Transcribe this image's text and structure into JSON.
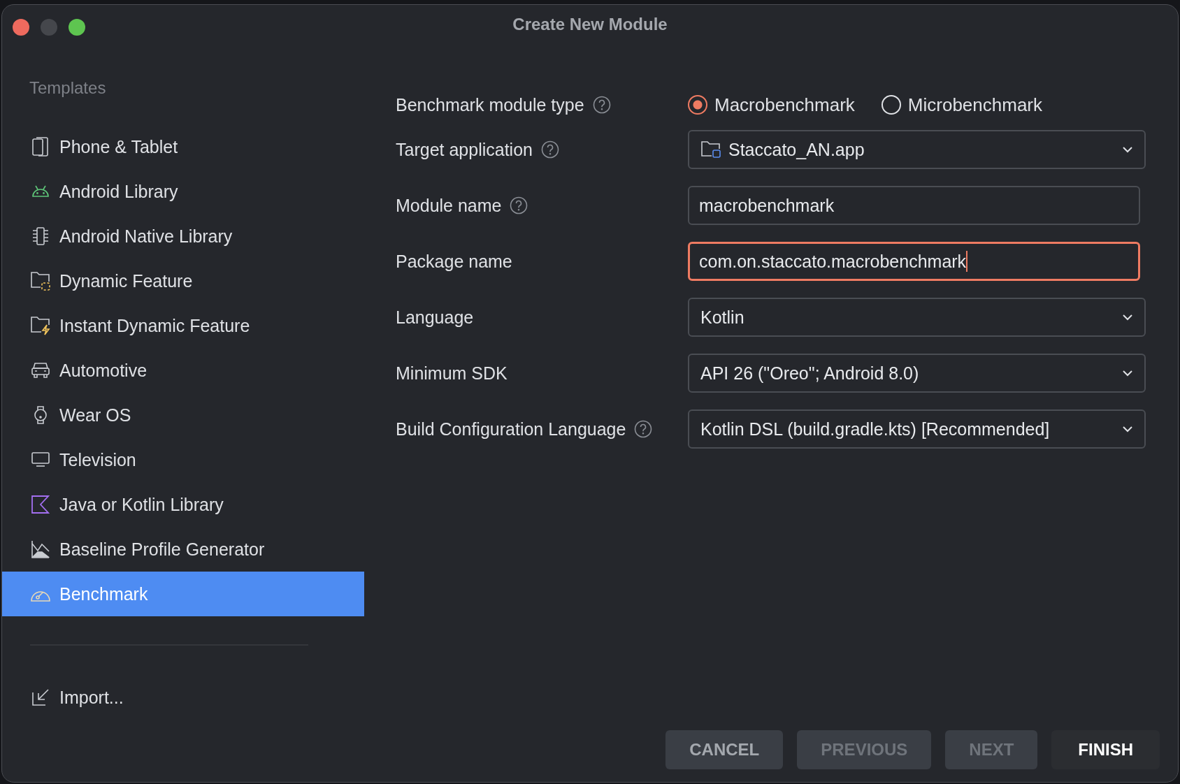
{
  "window": {
    "title": "Create New Module"
  },
  "sidebar": {
    "heading": "Templates",
    "items": [
      {
        "label": "Phone & Tablet",
        "selected": false
      },
      {
        "label": "Android Library",
        "selected": false
      },
      {
        "label": "Android Native Library",
        "selected": false
      },
      {
        "label": "Dynamic Feature",
        "selected": false
      },
      {
        "label": "Instant Dynamic Feature",
        "selected": false
      },
      {
        "label": "Automotive",
        "selected": false
      },
      {
        "label": "Wear OS",
        "selected": false
      },
      {
        "label": "Television",
        "selected": false
      },
      {
        "label": "Java or Kotlin Library",
        "selected": false
      },
      {
        "label": "Baseline Profile Generator",
        "selected": false
      },
      {
        "label": "Benchmark",
        "selected": true
      }
    ],
    "import": {
      "label": "Import..."
    }
  },
  "form": [
    {
      "kind": "radio",
      "label": "Benchmark module type",
      "help": true,
      "options": [
        {
          "label": "Macrobenchmark",
          "selected": true
        },
        {
          "label": "Microbenchmark",
          "selected": false
        }
      ]
    },
    {
      "kind": "dropdown",
      "label": "Target application",
      "help": true,
      "value": "Staccato_AN.app",
      "folder_icon": true
    },
    {
      "kind": "text",
      "label": "Module name",
      "help": true,
      "value": "macrobenchmark",
      "focused": false
    },
    {
      "kind": "text",
      "label": "Package name",
      "help": false,
      "value": "com.on.staccato.macrobenchmark",
      "focused": true
    },
    {
      "kind": "dropdown",
      "label": "Language",
      "help": false,
      "value": "Kotlin",
      "folder_icon": false
    },
    {
      "kind": "dropdown",
      "label": "Minimum SDK",
      "help": false,
      "value": "API 26 (\"Oreo\"; Android 8.0)",
      "folder_icon": false
    },
    {
      "kind": "dropdown",
      "label": "Build Configuration Language",
      "help": true,
      "value": "Kotlin DSL (build.gradle.kts) [Recommended]",
      "folder_icon": false
    }
  ],
  "buttons": [
    {
      "label": "CANCEL",
      "disabled": false,
      "default": false
    },
    {
      "label": "PREVIOUS",
      "disabled": true,
      "default": false
    },
    {
      "label": "NEXT",
      "disabled": true,
      "default": false
    },
    {
      "label": "FINISH",
      "disabled": false,
      "default": true
    }
  ]
}
